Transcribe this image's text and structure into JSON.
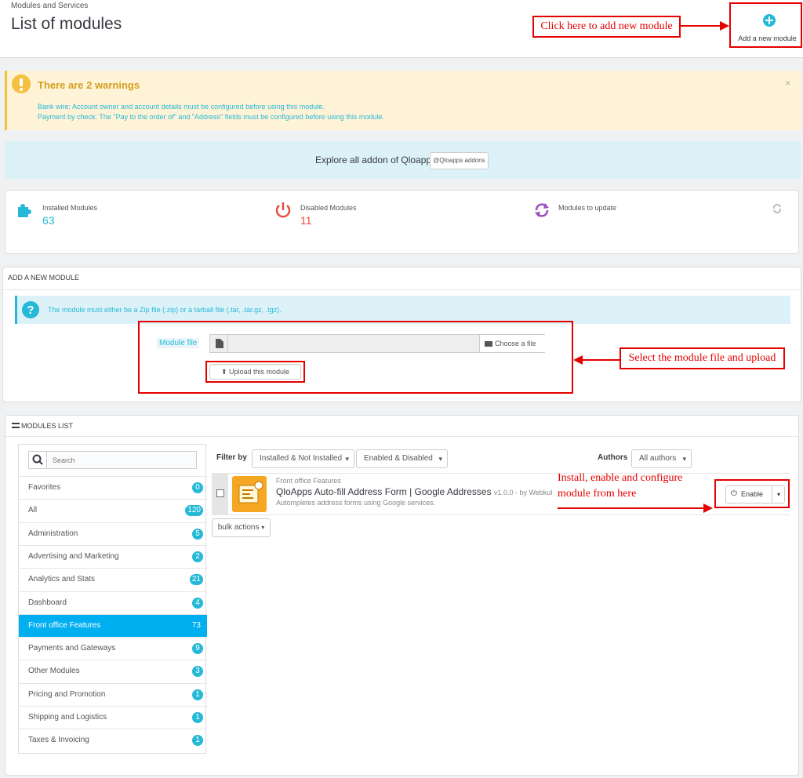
{
  "header": {
    "breadcrumb": "Modules and Services",
    "title": "List of modules",
    "add_label": "Add a new module"
  },
  "annotations": {
    "add_module": "Click here to add new module",
    "upload": "Select the module file and upload",
    "install_line1": "Install, enable and configure",
    "install_line2": "module from here"
  },
  "warnings": {
    "title": "There are 2 warnings",
    "items": [
      "Bank wire: Account owner and account details must be configured before using this module.",
      "Payment by check: The \"Pay to the order of\" and \"Address\" fields must be configured before using this module."
    ],
    "close": "×"
  },
  "explore": {
    "text": "Explore all addon of Qloapps",
    "button": "@Qloapps addons"
  },
  "stats": {
    "installed_label": "Installed Modules",
    "installed_count": "63",
    "disabled_label": "Disabled Modules",
    "disabled_count": "11",
    "update_label": "Modules to update"
  },
  "add_module": {
    "heading": "ADD A NEW MODULE",
    "info": "The module must either be a Zip file (.zip) or a tarball file (.tar, .tar.gz, .tgz).",
    "file_label": "Module file",
    "choose": "Choose a file",
    "upload": "Upload this module"
  },
  "modules_list": {
    "heading": "MODULES LIST",
    "search_placeholder": "Search",
    "categories": [
      {
        "label": "Favorites",
        "count": "0"
      },
      {
        "label": "All",
        "count": "120"
      },
      {
        "label": "Administration",
        "count": "5"
      },
      {
        "label": "Advertising and Marketing",
        "count": "2"
      },
      {
        "label": "Analytics and Stats",
        "count": "21"
      },
      {
        "label": "Dashboard",
        "count": "4"
      },
      {
        "label": "Front office Features",
        "count": "73"
      },
      {
        "label": "Payments and Gateways",
        "count": "9"
      },
      {
        "label": "Other Modules",
        "count": "3"
      },
      {
        "label": "Pricing and Promotion",
        "count": "1"
      },
      {
        "label": "Shipping and Logistics",
        "count": "1"
      },
      {
        "label": "Taxes & Invoicing",
        "count": "1"
      }
    ],
    "filter_label": "Filter by",
    "filter_install": "Installed & Not Installed",
    "filter_enable": "Enabled & Disabled",
    "authors_label": "Authors",
    "authors_value": "All authors",
    "module": {
      "category": "Front office Features",
      "name": "QloApps Auto-fill Address Form | Google Addresses",
      "version": "v1.0.0 - by Webkul",
      "description": "Autompletes address forms using Google services.",
      "action": "Enable"
    },
    "bulk": "bulk actions"
  },
  "colors": {
    "accent": "#25b9d7",
    "warning_bg": "#fff3d7",
    "annotation": "#e50000",
    "active_category": "#00aff0"
  }
}
